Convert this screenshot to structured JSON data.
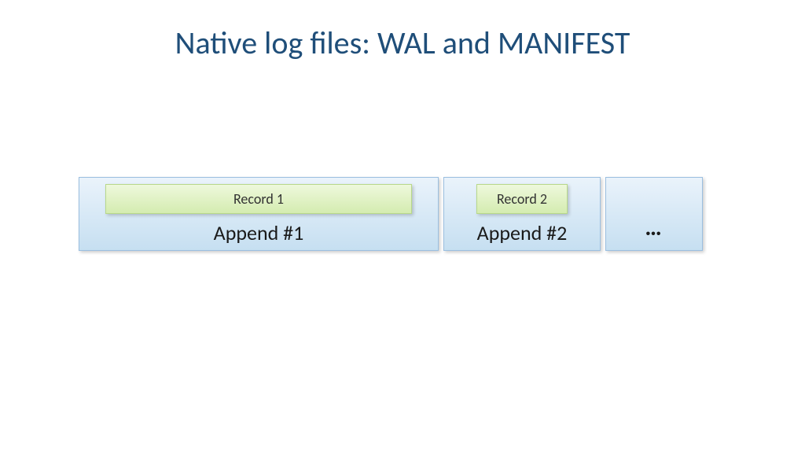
{
  "title": "Native log files: WAL and MANIFEST",
  "blocks": [
    {
      "record": "Record 1",
      "label": "Append #1"
    },
    {
      "record": "Record 2",
      "label": "Append #2"
    },
    {
      "ellipsis": "…"
    }
  ]
}
